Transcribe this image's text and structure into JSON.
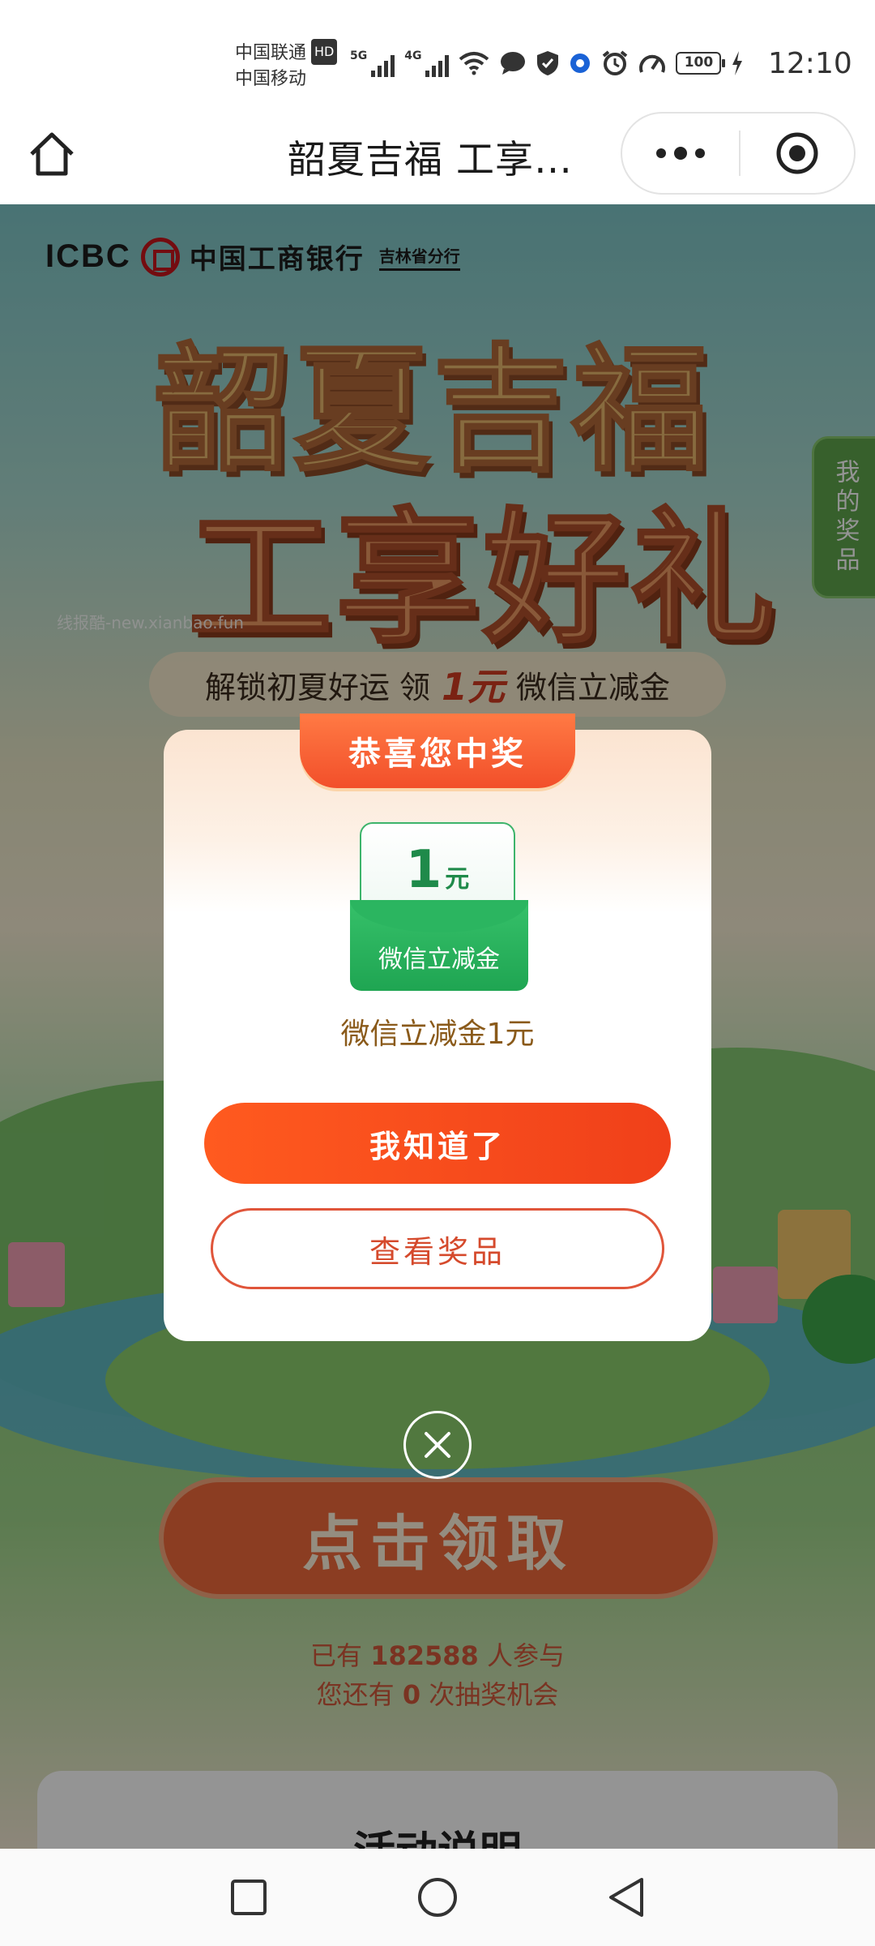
{
  "status_bar": {
    "carrier_1": "中国联通",
    "carrier_1_badge": "HD",
    "carrier_2": "中国移动",
    "sim1_label": "5G",
    "sim2_label": "4G",
    "battery": "100",
    "time": "12:10"
  },
  "title_bar": {
    "title": "韶夏吉福 工享…"
  },
  "page": {
    "brand": {
      "abbr": "ICBC",
      "bank_name": "中国工商银行",
      "branch": "吉林省分行"
    },
    "hero_line_1": "韶夏吉福",
    "hero_line_2": "工享好礼",
    "watermark": "线报酷-new.xianbao.fun",
    "subtitle_prefix": "解锁初夏好运  领",
    "subtitle_amount": "1元",
    "subtitle_suffix": "微信立减金",
    "my_prizes_label": "我的奖品",
    "claim_button": "点击领取",
    "participants_prefix": "已有",
    "participants_count": "182588",
    "participants_suffix": "人参与",
    "chances_prefix": "您还有",
    "chances_count": "0",
    "chances_suffix": "次抽奖机会",
    "rules_title": "- 活动说明 -"
  },
  "modal": {
    "ribbon": "恭喜您中奖",
    "coupon_value": "1",
    "coupon_unit": "元",
    "coupon_label": "微信立减金",
    "prize_description": "微信立减金1元",
    "primary_button": "我知道了",
    "secondary_button": "查看奖品"
  },
  "colors": {
    "accent": "#f0401a",
    "coupon_green": "#1fa552",
    "prize_text": "#8a5a1a"
  }
}
